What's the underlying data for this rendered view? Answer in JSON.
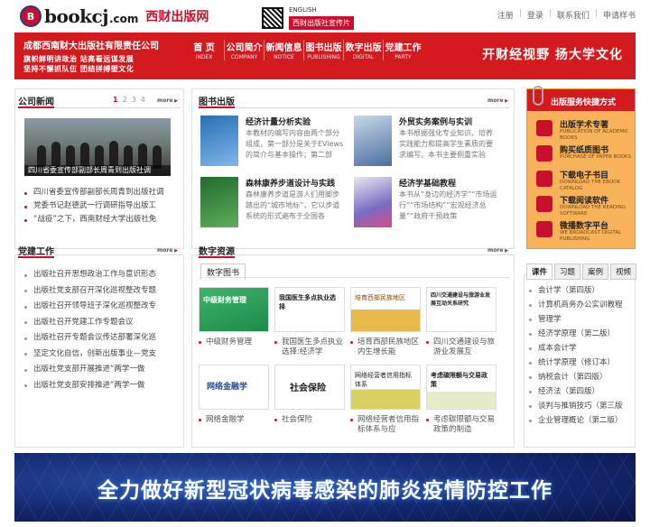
{
  "site": {
    "logo_word": "bookcj",
    "logo_com": ".com",
    "logo_cn": "西财出版网",
    "english": "ENGLISH",
    "promo": "西财出版社宣传片"
  },
  "toplinks": [
    "注册",
    "登录",
    "联系我们",
    "申请样书"
  ],
  "header": {
    "pub_name": "成都西南财大出版社有限责任公司",
    "slogan1": "旗帜鲜明讲政治  站高看远谋发展",
    "slogan2": "坚持不懈抓队伍  团结拼搏塑文化",
    "slogan_right": "开财经视野  扬大学文化"
  },
  "nav": [
    {
      "cn": "首 页",
      "en": "INDEX"
    },
    {
      "cn": "公司简介",
      "en": "COMPANY"
    },
    {
      "cn": "新闻信息",
      "en": "NOTICE"
    },
    {
      "cn": "图书出版",
      "en": "PUBLISHING"
    },
    {
      "cn": "数字出版",
      "en": "DIGITAL"
    },
    {
      "cn": "党建工作",
      "en": "PARTY"
    }
  ],
  "more": "more",
  "news": {
    "title": "公司新闻",
    "pages": [
      "1",
      "2",
      "3",
      "4"
    ],
    "photo_caption": "四川省委宣传部副部长周青到出版社调",
    "items": [
      "四川省委宣传部副部长周青到出版社调",
      "党委书记赵德武一行调研指导出版工",
      "“战疫”之下，西南财经大学出版社免"
    ]
  },
  "party": {
    "title": "党建工作",
    "items": [
      "出版社召开思想政治工作与意识形态",
      "出版社党支部召开深化巡视整改专题",
      "出版社召开领导班子深化巡视整改专",
      "出版社召开党建工作专题会议",
      "出版社召开专题会议传达部署深化巡",
      "坚定文化自信，创新出版事业—党支",
      "出版社党支部开展推进“两学一做",
      "出版社党支部安排推进“两学一做"
    ]
  },
  "books": {
    "title": "图书出版",
    "items": [
      {
        "title": "经济计量分析实验",
        "desc": "本教材的编写内容由两个部分组成，第一部分是关于EViews的简介与基本操作；第二部"
      },
      {
        "title": "外贸实务案例与实训",
        "desc": "本书根据强化专业知识、培养实践能力和提高学生素质的要求编写。本书主要侧重实验"
      },
      {
        "title": "森林康养步道设计与实践",
        "desc": "森林康养步道是游人们用脚步踏出的“城市地标”，它以步道系统的形式遍布于全国各"
      },
      {
        "title": "经济学基础教程",
        "desc": "本书从“身边的经济学”“市场运行”“市场结构”“宏观经济总量”“政府干预政策"
      }
    ]
  },
  "digital": {
    "title": "数字资源",
    "subtab": "数字图书",
    "items": [
      {
        "label": "中级财务管理",
        "cover_text": "中级财务管理"
      },
      {
        "label": "我国医生多点执业选择:经济学",
        "cover_text": "我国医生多点执业选择"
      },
      {
        "label": "培育西部民族地区内生增长能",
        "cover_text": "培育西部民族地区"
      },
      {
        "label": "四川交通建设与旅游业发展互",
        "cover_text": "四川交通建设与旅游业发展互动关系研究"
      },
      {
        "label": "网络金融学",
        "cover_text": "网络金融学"
      },
      {
        "label": "社会保险",
        "cover_text": "社会保险"
      },
      {
        "label": "网络经营者信用指标体系与应",
        "cover_text": "网络经营者信用指标体系"
      },
      {
        "label": "考虑碳限额与交易政策的制造",
        "cover_text": "考虑碳限额与交易政策"
      }
    ]
  },
  "services": {
    "title": "出版服务快捷方式",
    "items": [
      {
        "title": "出版学术专著",
        "en": "PUBLICATION OF ACADEMIC BOOKS"
      },
      {
        "title": "购买纸质图书",
        "en": "PURCHASE OF PAPER BOOKS"
      },
      {
        "title": "下载电子书目",
        "en": "DOWNLOAD THE EBOOK CATALOG"
      },
      {
        "title": "下载阅读软件",
        "en": "DOWNLOAD THE READING SOFTWARE"
      },
      {
        "title": "微播数字平台",
        "en": "WE BROADCAST DIGITAL PUBLISHING"
      }
    ]
  },
  "courses": {
    "tabs": [
      "课件",
      "习题",
      "案例",
      "视频"
    ],
    "items": [
      "会计学（第四版）",
      "计算机商务办公实训教程",
      "管理学",
      "经济学原理（第二版）",
      "成本会计学",
      "统计学原理（修订本）",
      "纳税会计（第四版）",
      "经济法（第四版）",
      "谈判与推销技巧（第三版",
      "企业管理概论（第二版）"
    ]
  },
  "banner": {
    "text": "全力做好新型冠状病毒感染的肺炎疫情防控工作"
  }
}
